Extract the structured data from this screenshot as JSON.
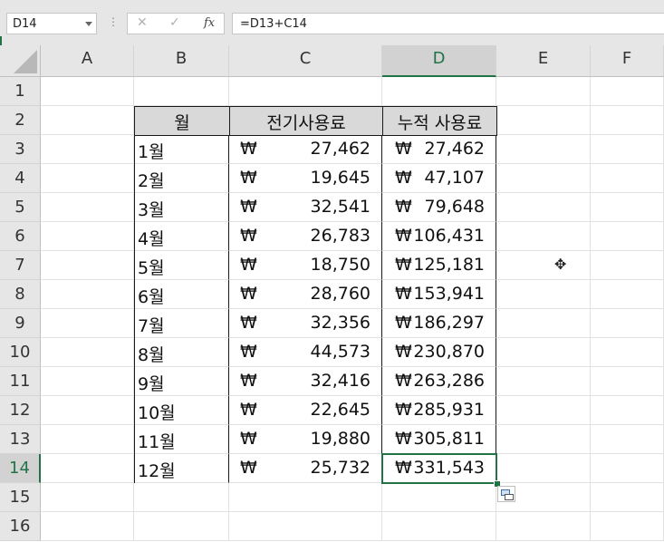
{
  "name_box": {
    "value": "D14"
  },
  "formula_bar": {
    "cancel_icon": "✕",
    "enter_icon": "✓",
    "fx_label": "fx",
    "formula": "=D13+C14"
  },
  "columns": [
    "A",
    "B",
    "C",
    "D",
    "E",
    "F"
  ],
  "selected_column": "D",
  "rows": [
    "1",
    "2",
    "3",
    "4",
    "5",
    "6",
    "7",
    "8",
    "9",
    "10",
    "11",
    "12",
    "13",
    "14",
    "15",
    "16"
  ],
  "selected_row": "14",
  "table": {
    "headers": [
      "월",
      "전기사용료",
      "누적 사용료"
    ],
    "currency_symbol": "₩",
    "data": [
      {
        "month": "1월",
        "usage": "27,462",
        "cumulative": "27,462"
      },
      {
        "month": "2월",
        "usage": "19,645",
        "cumulative": "47,107"
      },
      {
        "month": "3월",
        "usage": "32,541",
        "cumulative": "79,648"
      },
      {
        "month": "4월",
        "usage": "26,783",
        "cumulative": "106,431"
      },
      {
        "month": "5월",
        "usage": "18,750",
        "cumulative": "125,181"
      },
      {
        "month": "6월",
        "usage": "28,760",
        "cumulative": "153,941"
      },
      {
        "month": "7월",
        "usage": "32,356",
        "cumulative": "186,297"
      },
      {
        "month": "8월",
        "usage": "44,573",
        "cumulative": "230,870"
      },
      {
        "month": "9월",
        "usage": "32,416",
        "cumulative": "263,286"
      },
      {
        "month": "10월",
        "usage": "22,645",
        "cumulative": "285,931"
      },
      {
        "month": "11월",
        "usage": "19,880",
        "cumulative": "305,811"
      },
      {
        "month": "12월",
        "usage": "25,732",
        "cumulative": "331,543"
      }
    ]
  },
  "colors": {
    "accent": "#217346",
    "header_fill": "#d9d9d9"
  }
}
